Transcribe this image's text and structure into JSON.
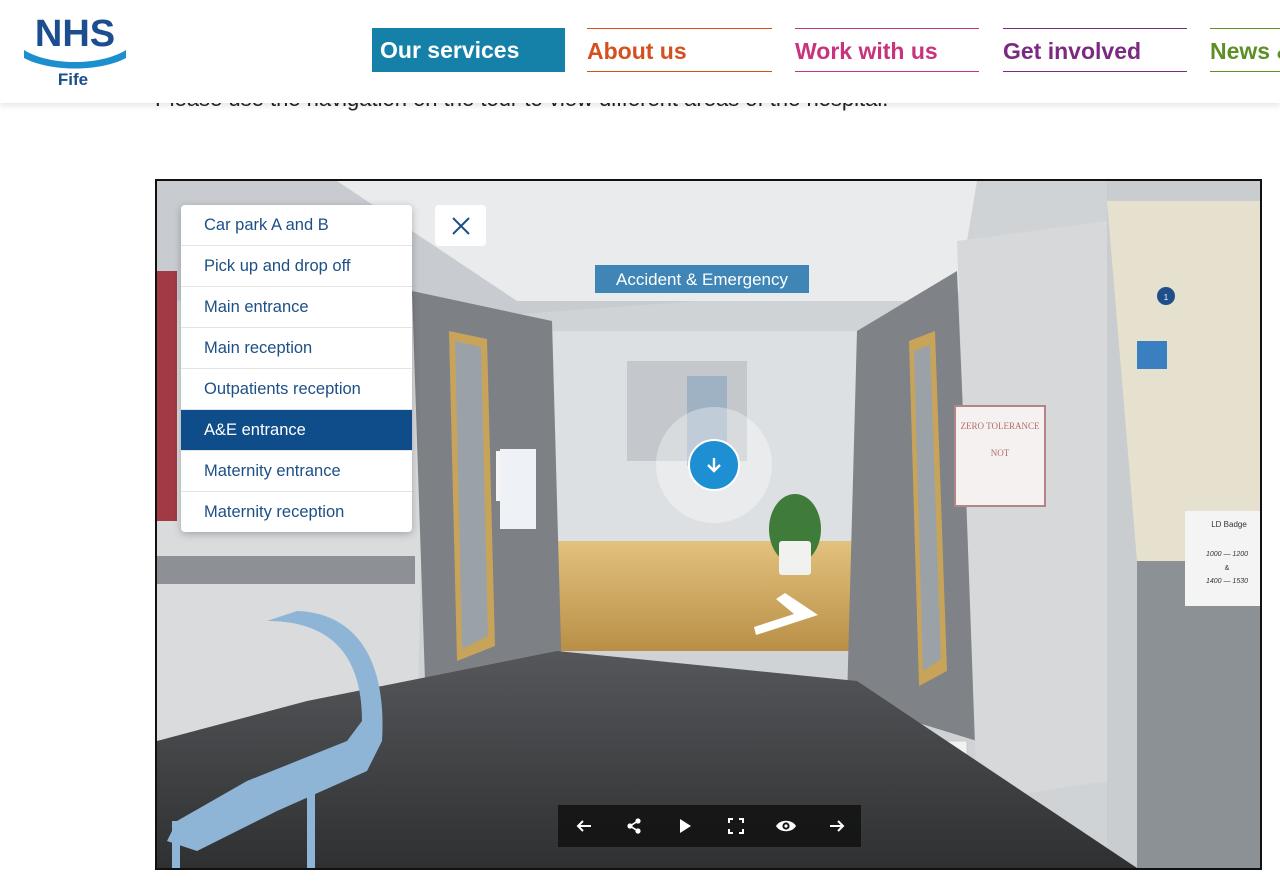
{
  "header": {
    "logo": {
      "name": "NHS",
      "sub": "Fife",
      "color": "#1b4d8f"
    },
    "nav": [
      {
        "label": "Our services",
        "color": "#1681a8",
        "active": true
      },
      {
        "label": "About us",
        "color": "#d4501f"
      },
      {
        "label": "Work with us",
        "color": "#c8337e"
      },
      {
        "label": "Get involved",
        "color": "#7b2a82"
      },
      {
        "label": "News & events",
        "color": "#5d8f25"
      }
    ]
  },
  "intro": "Please use the navigation on the tour to view different areas of the hospital.",
  "tour": {
    "locations": [
      "Car park A and B",
      "Pick up and drop off",
      "Main entrance",
      "Main reception",
      "Outpatients reception",
      "A&E entrance",
      "Maternity entrance",
      "Maternity reception"
    ],
    "active_location": "A&E entrance",
    "scene": {
      "sign": "Accident & Emergency",
      "poster_title": "ZERO TOLERANCE",
      "poster_line1": "NOT",
      "bay_number": "1",
      "hours_title": "LD Badge",
      "hours_1": "1000 — 1200",
      "hours_and": "&",
      "hours_2": "1400 — 1530"
    },
    "controls": [
      "back-icon",
      "share-icon",
      "play-icon",
      "fullscreen-icon",
      "view-icon",
      "forward-icon"
    ]
  },
  "colors": {
    "menu_active": "#0f4c8a",
    "menu_text": "#1d4f87",
    "hotspot": "#1f8fd3"
  }
}
